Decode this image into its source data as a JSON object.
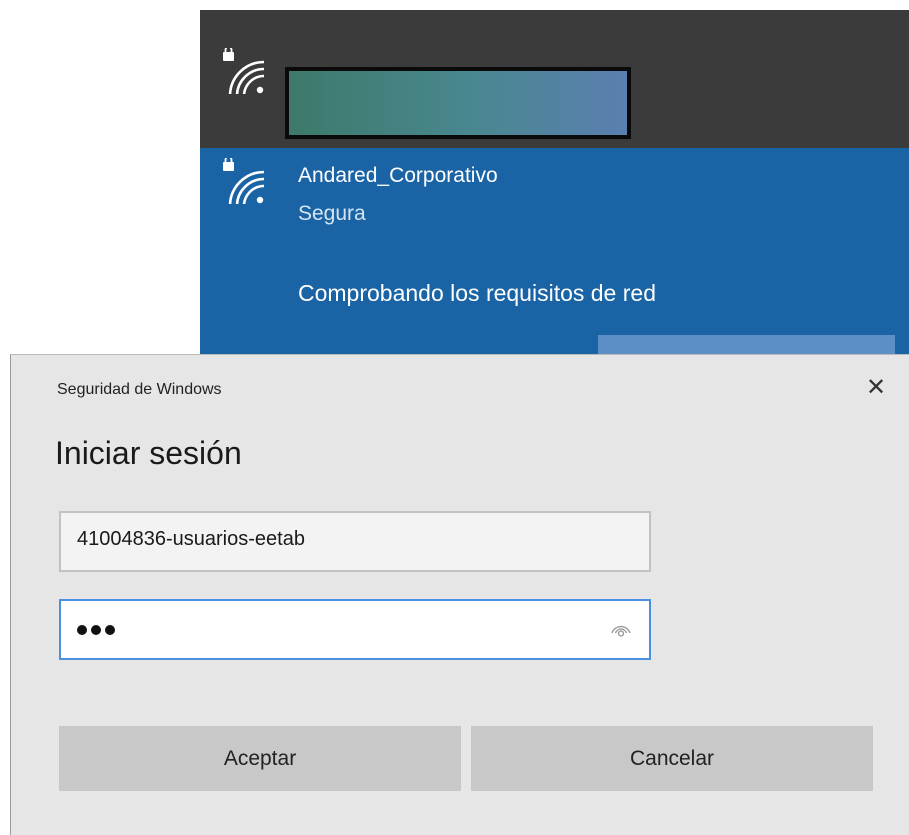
{
  "networks": {
    "connected": {
      "name_redacted": true,
      "icon": "wifi-locked-icon"
    },
    "selected": {
      "name": "Andared_Corporativo",
      "status": "Segura",
      "progress": "Comprobando los requisitos de red",
      "icon": "wifi-locked-icon"
    }
  },
  "dialog": {
    "window_title": "Seguridad de Windows",
    "close_glyph": "✕",
    "heading": "Iniciar sesión",
    "username": {
      "value": "41004836-usuarios-eetab"
    },
    "password": {
      "masked_length": 3,
      "reveal_icon": "eye-icon"
    },
    "buttons": {
      "ok": "Aceptar",
      "cancel": "Cancelar"
    }
  },
  "colors": {
    "flyout_dark": "#3b3b3b",
    "flyout_selected": "#1a64a6",
    "dialog_bg": "#e6e6e6",
    "focus_border": "#4b8fe0",
    "button_bg": "#c8c8c8"
  }
}
